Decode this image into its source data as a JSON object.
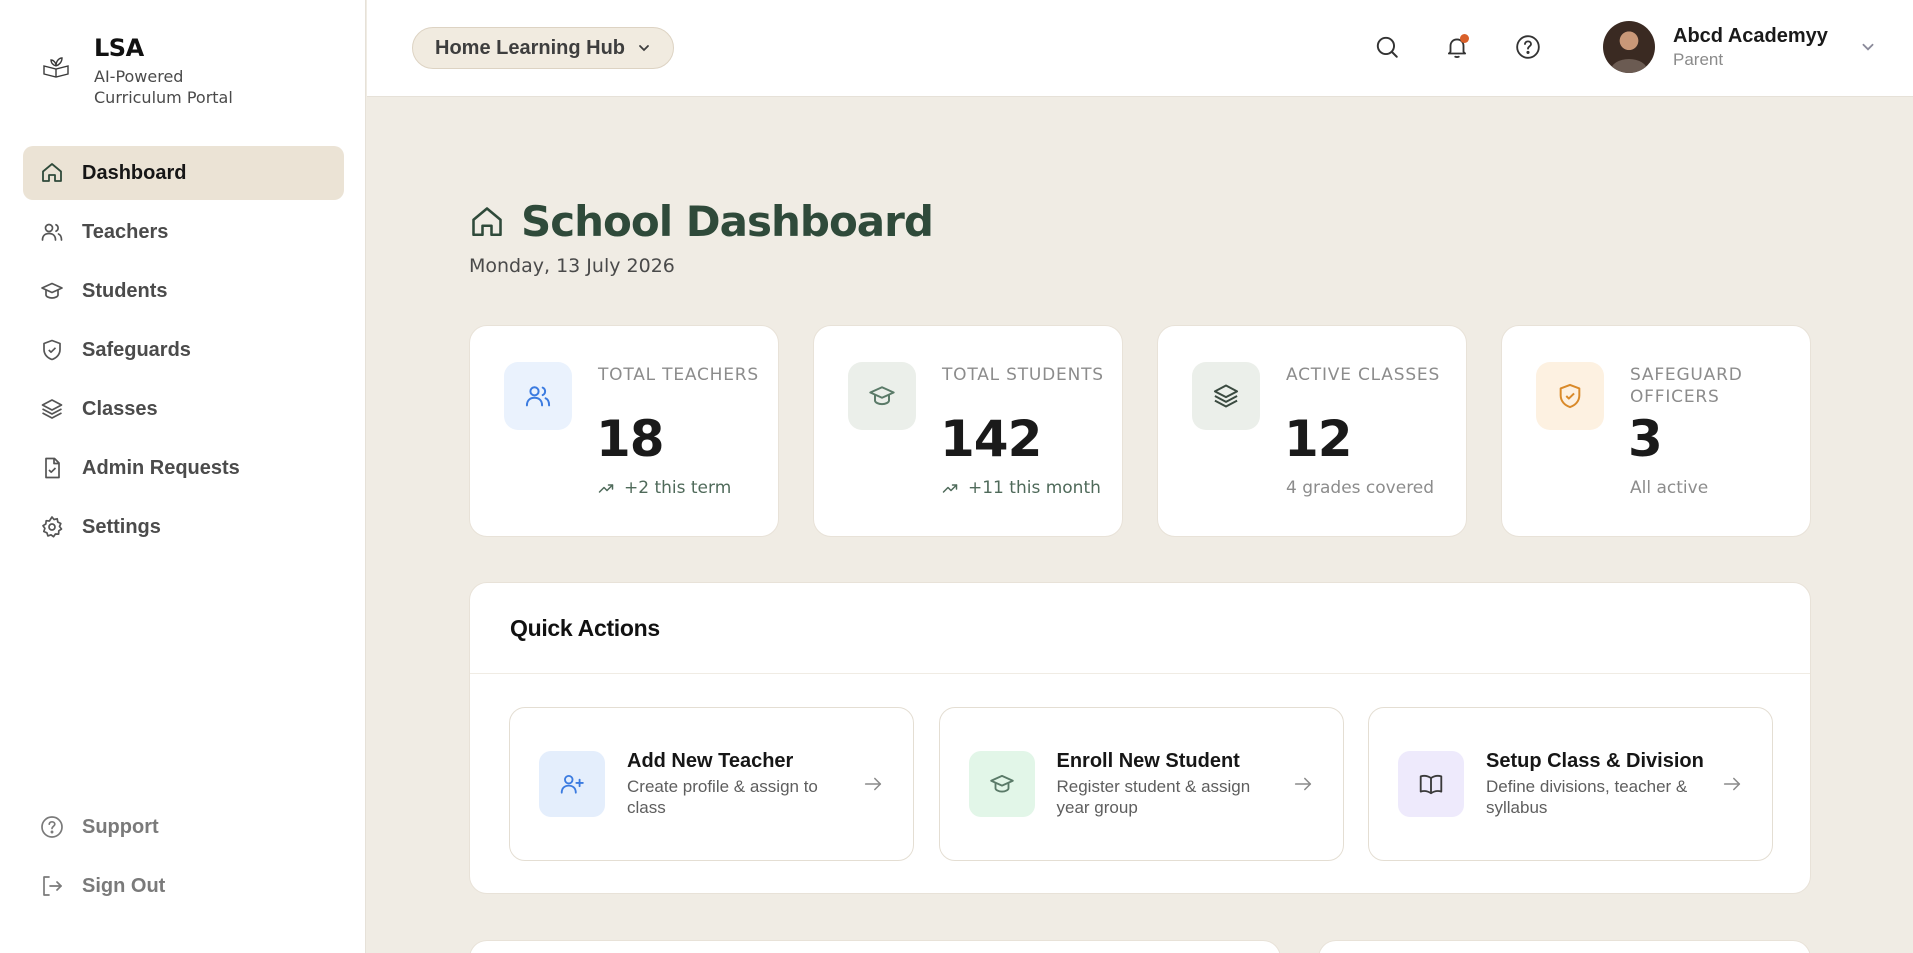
{
  "brand": {
    "title": "LSA",
    "subtitle": "AI-Powered Curriculum Portal"
  },
  "sidebar": {
    "items": [
      {
        "label": "Dashboard",
        "icon": "home-icon",
        "active": true
      },
      {
        "label": "Teachers",
        "icon": "users-icon"
      },
      {
        "label": "Students",
        "icon": "graduation-cap-icon"
      },
      {
        "label": "Safeguards",
        "icon": "shield-check-icon"
      },
      {
        "label": "Classes",
        "icon": "layers-icon"
      },
      {
        "label": "Admin Requests",
        "icon": "file-check-icon"
      },
      {
        "label": "Settings",
        "icon": "gear-icon"
      }
    ],
    "bottom": [
      {
        "label": "Support",
        "icon": "help-circle-icon"
      },
      {
        "label": "Sign Out",
        "icon": "log-out-icon"
      }
    ]
  },
  "topbar": {
    "hub_label": "Home Learning Hub",
    "profile": {
      "name": "Abcd Academyy",
      "role": "Parent"
    },
    "notification_dot_color": "#d9602a"
  },
  "main": {
    "title": "School Dashboard",
    "date": "Monday, 13 July 2026",
    "stats": [
      {
        "label": "Total Teachers",
        "value": "18",
        "sub": "+2 this term",
        "trend": true,
        "icon": "users-icon",
        "tint": "#eaf2fd",
        "color": "#3b7be0"
      },
      {
        "label": "Total Students",
        "value": "142",
        "sub": "+11 this month",
        "trend": true,
        "icon": "graduation-cap-icon",
        "tint": "#ebefea",
        "color": "#5a7a68"
      },
      {
        "label": "Active Classes",
        "value": "12",
        "sub": "4 grades covered",
        "trend": false,
        "icon": "layers-icon",
        "tint": "#ebefea",
        "color": "#3a4a40"
      },
      {
        "label": "Safeguard Officers",
        "value": "3",
        "sub": "All active",
        "trend": false,
        "icon": "shield-check-icon",
        "tint": "#fdf1e1",
        "color": "#d98a2a"
      }
    ],
    "quick_actions": {
      "title": "Quick Actions",
      "items": [
        {
          "name": "Add New Teacher",
          "desc": "Create profile & assign to class",
          "icon": "user-plus-icon",
          "tint": "#e4eefc",
          "color": "#3b7be0"
        },
        {
          "name": "Enroll New Student",
          "desc": "Register student & assign year group",
          "icon": "graduation-cap-icon",
          "tint": "#e2f6e8",
          "color": "#5a7a68"
        },
        {
          "name": "Setup Class & Division",
          "desc": "Define divisions, teacher & syllabus",
          "icon": "book-open-icon",
          "tint": "#eeeafc",
          "color": "#3a3a3a"
        }
      ]
    }
  }
}
